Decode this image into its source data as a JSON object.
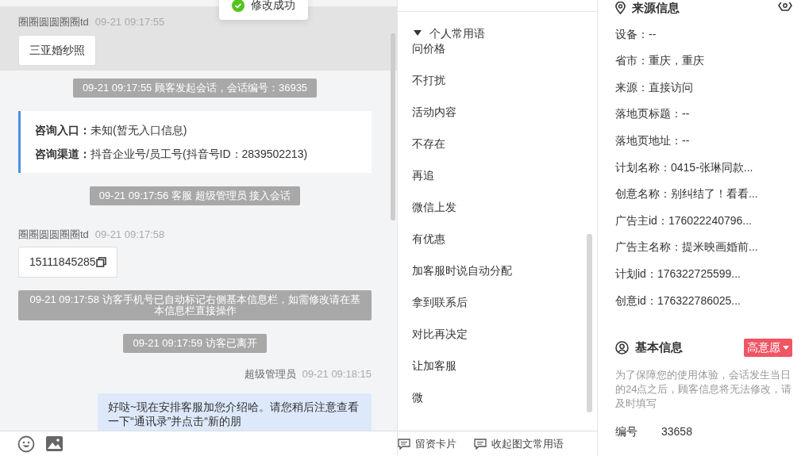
{
  "toast": {
    "text": "修改成功"
  },
  "chat": {
    "messages": [
      {
        "kind": "customer",
        "name": "圈圈圆圆圈圈td",
        "time": "09-21 09:17:55",
        "text": "三亚婚纱照",
        "copyable": false,
        "highlighted": true
      },
      {
        "kind": "system",
        "text": "09-21 09:17:55 顾客发起会话，会话编号：36935"
      },
      {
        "kind": "entry",
        "rows": [
          {
            "label": "咨询入口：",
            "value": "未知(暂无入口信息)"
          },
          {
            "label": "咨询渠道：",
            "value": "抖音企业号/员工号(抖音号ID：2839502213)"
          }
        ]
      },
      {
        "kind": "system",
        "text": "09-21 09:17:56 客服 超级管理员 接入会话"
      },
      {
        "kind": "customer",
        "name": "圈圈圆圆圈圈td",
        "time": "09-21 09:17:58",
        "text": "15111845285",
        "copyable": true,
        "highlighted": false
      },
      {
        "kind": "system",
        "text": "09-21 09:17:58 访客手机号已自动标记右侧基本信息栏，如需修改请在基本信息栏直接操作"
      },
      {
        "kind": "system",
        "text": "09-21 09:17:59 访客已离开"
      },
      {
        "kind": "agent",
        "name": "超级管理员",
        "time": "09-21 09:18:15",
        "text": "好哒~现在安排客服加您介绍哈。请您稍后注意查看一下“通讯录”并点击“新的朋"
      }
    ]
  },
  "phrases": {
    "group": "个人常用语",
    "expanded": true,
    "items": [
      "问价格",
      "不打扰",
      "活动内容",
      "不存在",
      "再追",
      "微信上发",
      "有优惠",
      "加客服时说自动分配",
      "拿到联系后",
      "对比再决定",
      "让加客服",
      "微"
    ]
  },
  "phrase_actions": [
    "留资卡片",
    "收起图文常用语"
  ],
  "source_info": {
    "title": "来源信息",
    "fields": [
      "设备：--",
      "省市：重庆，重庆",
      "来源：直接访问",
      "落地页标题：--",
      "落地页地址：--",
      "计划名称：0415-张琳同款...",
      "创意名称：别纠结了！看看...",
      "广告主id：176022240796...",
      "广告主名称：提米映画婚前...",
      "计划id：176322725599...",
      "创意id：176322786025..."
    ]
  },
  "basic_info": {
    "title": "基本信息",
    "intent": "高意愿",
    "notice": "为了保障您的使用体验，会话发生当日的24点之后，顾客信息将无法修改，请及时填写",
    "fields": [
      {
        "label": "编号",
        "value": "33658"
      }
    ]
  }
}
